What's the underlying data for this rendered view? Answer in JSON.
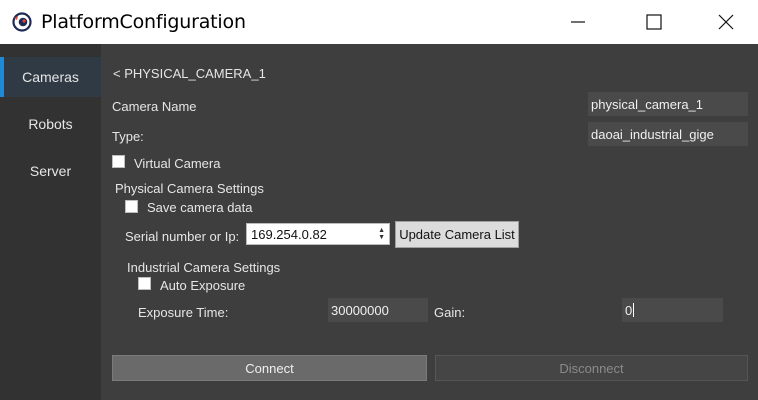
{
  "window": {
    "title": "PlatformConfiguration",
    "icon": "camera-eye-icon",
    "controls": [
      "minimize-icon",
      "maximize-icon",
      "close-icon"
    ]
  },
  "sidebar": {
    "items": [
      {
        "label": "Cameras",
        "active": true
      },
      {
        "label": "Robots",
        "active": false
      },
      {
        "label": "Server",
        "active": false
      }
    ]
  },
  "main": {
    "breadcrumb": "< PHYSICAL_CAMERA_1",
    "camera_name_label": "Camera Name",
    "camera_name_value": "physical_camera_1",
    "type_label": "Type:",
    "type_value": "daoai_industrial_gige",
    "virtual_camera_label": "Virtual Camera",
    "physical_settings_title": "Physical Camera Settings",
    "save_camera_data_label": "Save camera data",
    "serial_label": "Serial number or Ip:",
    "serial_value": "169.254.0.82",
    "update_button": "Update Camera List",
    "industrial_settings_title": "Industrial Camera Settings",
    "auto_exposure_label": "Auto Exposure",
    "exposure_label": "Exposure Time:",
    "exposure_value": "30000000",
    "gain_label": "Gain:",
    "gain_value": "0",
    "connect_button": "Connect",
    "disconnect_button": "Disconnect"
  },
  "colors": {
    "accent": "#1f8bd6",
    "sidebar_bg": "#323232",
    "main_bg": "#3e3e3e",
    "field_bg": "#4a4a4a"
  }
}
